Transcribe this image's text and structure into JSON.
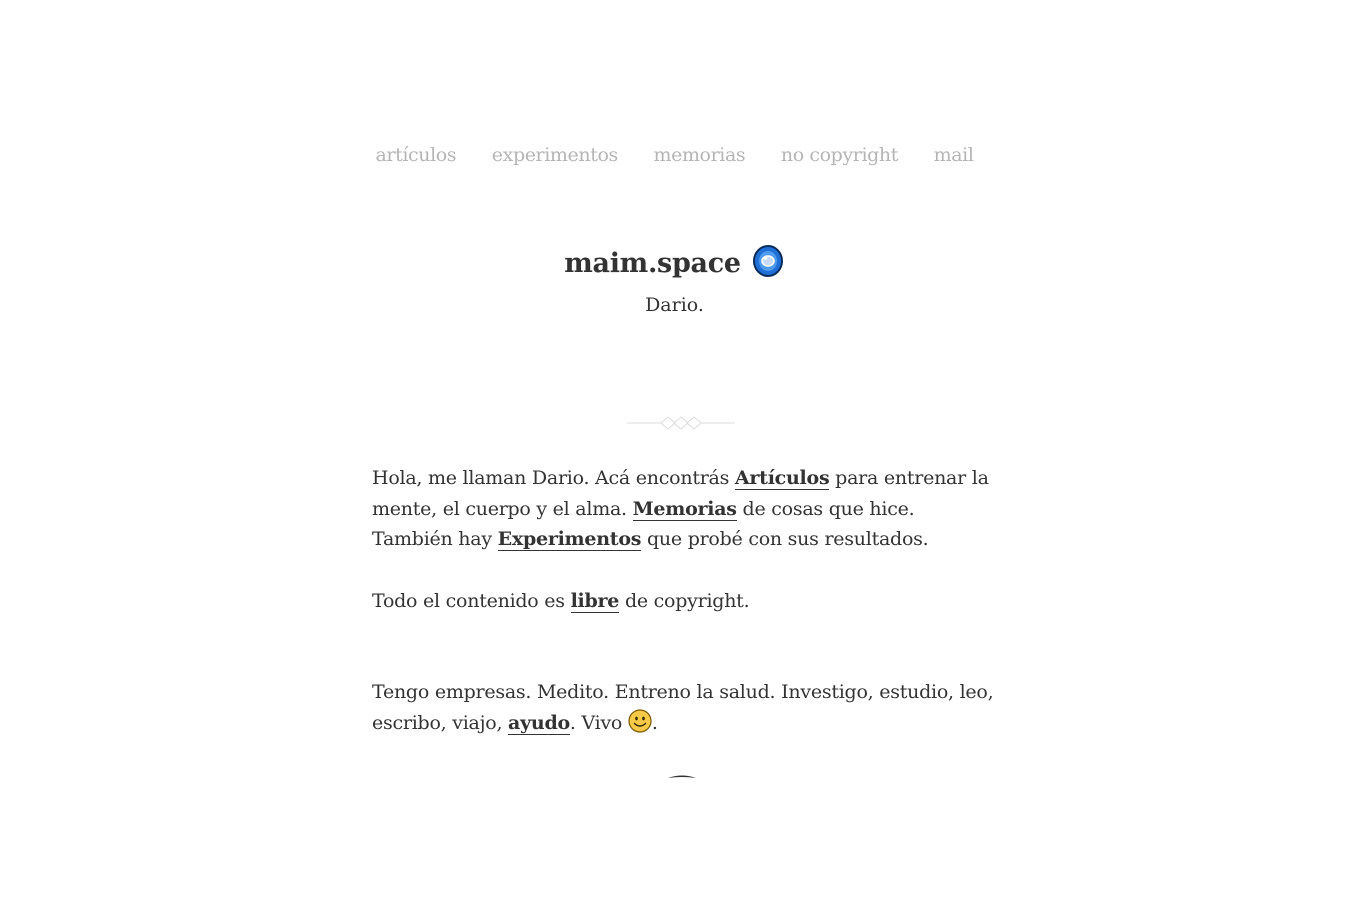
{
  "nav": {
    "items": [
      "artículos",
      "experimentos",
      "memorias",
      "no copyright",
      "mail"
    ]
  },
  "header": {
    "title": "maim.space",
    "logo_icon": "blue-gem-icon",
    "subtitle": "Dario."
  },
  "intro": {
    "t1": "Hola, me llaman Dario. Acá encontrás ",
    "link_articulos": "Artículos",
    "t2": " para entrenar la mente, el cuerpo y el alma. ",
    "link_memorias": "Memorias",
    "t3": " de cosas que hice. También hay ",
    "link_experimentos": "Experimentos",
    "t4": " que probé con sus resultados."
  },
  "copyright": {
    "t1": "Todo el contenido es ",
    "link_libre": "libre",
    "t2": " de copyright."
  },
  "about": {
    "t1": "Tengo empresas. Medito. Entreno la salud. Investigo, estudio, leo, escribo, viajo, ",
    "link_ayudo": "ayudo",
    "t2": ". Vivo ",
    "smile_icon": "smiling-face-icon",
    "t3": "."
  },
  "colors": {
    "text": "#333333",
    "nav": "#b5b5b5",
    "accent_blue": "#1f6fd6"
  }
}
